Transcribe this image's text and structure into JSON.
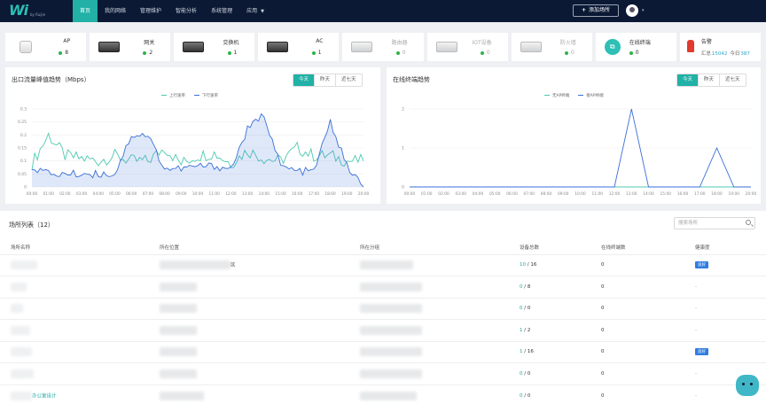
{
  "app": {
    "logo_text": "Wi",
    "logo_sub": "by Ruijie",
    "add_button": "添加场所"
  },
  "nav": [
    {
      "label": "首页",
      "active": true
    },
    {
      "label": "我的网络"
    },
    {
      "label": "管理维护"
    },
    {
      "label": "智能分析"
    },
    {
      "label": "系统管理"
    },
    {
      "label": "应用",
      "has_caret": true
    }
  ],
  "stats": [
    {
      "label": "AP",
      "value": "8",
      "icon": "ap-device-icon"
    },
    {
      "label": "网关",
      "value": "2",
      "icon": "gateway-device-icon"
    },
    {
      "label": "交换机",
      "value": "1",
      "icon": "switch-device-icon"
    },
    {
      "label": "AC",
      "value": "1",
      "icon": "ac-device-icon"
    },
    {
      "label": "路由器",
      "value": "0",
      "icon": "router-device-icon",
      "dim": true
    },
    {
      "label": "IOT设备",
      "value": "0",
      "icon": "iot-device-icon",
      "dim": true
    },
    {
      "label": "防火墙",
      "value": "0",
      "icon": "firewall-device-icon",
      "dim": true
    },
    {
      "label": "在线终端",
      "value": "0",
      "icon": "terminal-icon"
    }
  ],
  "alarm": {
    "label": "告警",
    "today_label": "今日",
    "total_label": "汇总",
    "total": "15042",
    "today": "387",
    "icon": "alarm-icon"
  },
  "traffic": {
    "title": "出口流量峰值趋势（Mbps）",
    "tabs": [
      "今天",
      "昨天",
      "近七天"
    ],
    "active_tab": 0
  },
  "clients": {
    "title": "在线终端趋势",
    "tabs": [
      "今天",
      "昨天",
      "近七天"
    ],
    "active_tab": 0
  },
  "chart_data": [
    {
      "type": "line",
      "title": "出口流量峰值趋势（Mbps）",
      "x": [
        "00:00",
        "01:00",
        "02:00",
        "03:00",
        "04:00",
        "05:00",
        "06:00",
        "07:00",
        "08:00",
        "09:00",
        "10:00",
        "11:00",
        "12:00",
        "13:00",
        "14:00",
        "15:00",
        "16:00",
        "17:00",
        "18:00",
        "19:00",
        "20:00"
      ],
      "ylim": [
        0,
        0.3
      ],
      "yticks": [
        "0",
        "0.05",
        "0.1",
        "0.15",
        "0.2",
        "0.25",
        "0.3"
      ],
      "series": [
        {
          "name": "上行速率",
          "color": "#4cc9b0",
          "values": [
            0.09,
            0.2,
            0.12,
            0.11,
            0.1,
            0.12,
            0.1,
            0.1,
            0.15,
            0.09,
            0.12,
            0.13,
            0.09,
            0.14,
            0.11,
            0.1,
            0.15,
            0.12,
            0.12,
            0.1,
            0.1
          ]
        },
        {
          "name": "下行速率",
          "color": "#3a6fd8",
          "values": [
            0.08,
            0.05,
            0.05,
            0.05,
            0.05,
            0.05,
            0.2,
            0.2,
            0.07,
            0.07,
            0.08,
            0.08,
            0.07,
            0.22,
            0.28,
            0.08,
            0.06,
            0.06,
            0.25,
            0.08,
            0.0
          ]
        }
      ]
    },
    {
      "type": "line",
      "title": "在线终端趋势",
      "x": [
        "00:00",
        "01:00",
        "02:00",
        "03:00",
        "04:00",
        "05:00",
        "06:00",
        "07:00",
        "08:00",
        "09:00",
        "10:00",
        "11:00",
        "12:00",
        "13:00",
        "14:00",
        "15:00",
        "16:00",
        "17:00",
        "18:00",
        "19:00",
        "20:00"
      ],
      "ylim": [
        0,
        2
      ],
      "yticks": [
        "0",
        "1",
        "2"
      ],
      "series": [
        {
          "name": "无AP终端",
          "color": "#4cc9b0",
          "values": [
            0,
            0,
            0,
            0,
            0,
            0,
            0,
            0,
            0,
            0,
            0,
            0,
            0,
            0,
            0,
            0,
            0,
            0,
            0,
            0,
            0
          ]
        },
        {
          "name": "接AP终端",
          "color": "#3a6fd8",
          "values": [
            0,
            0,
            0,
            0,
            0,
            0,
            0,
            0,
            0,
            0,
            0,
            0,
            0,
            2,
            0,
            0,
            0,
            0,
            1,
            0,
            0
          ]
        }
      ]
    }
  ],
  "list": {
    "title": "场所列表（12）",
    "search_placeholder": "搜索场所",
    "columns": [
      "场所名称",
      "所在位置",
      "所在分组",
      "设备总数",
      "在线终端数",
      "健康度"
    ],
    "rows": [
      {
        "location_suffix": "区",
        "devices_online": "10",
        "devices_total": "16",
        "terminals": "0",
        "health": "良好"
      },
      {
        "devices_online": "0",
        "devices_total": "8",
        "terminals": "0",
        "health": "-"
      },
      {
        "devices_online": "0",
        "devices_total": "0",
        "terminals": "0",
        "health": "-"
      },
      {
        "devices_online": "1",
        "devices_total": "2",
        "terminals": "0",
        "health": "-"
      },
      {
        "devices_online": "1",
        "devices_total": "16",
        "terminals": "0",
        "health": "良好"
      },
      {
        "devices_online": "0",
        "devices_total": "0",
        "terminals": "0",
        "health": "-"
      },
      {
        "name_suffix": "办公室设计",
        "devices_online": "0",
        "devices_total": "0",
        "terminals": "0",
        "health": "-"
      }
    ]
  }
}
